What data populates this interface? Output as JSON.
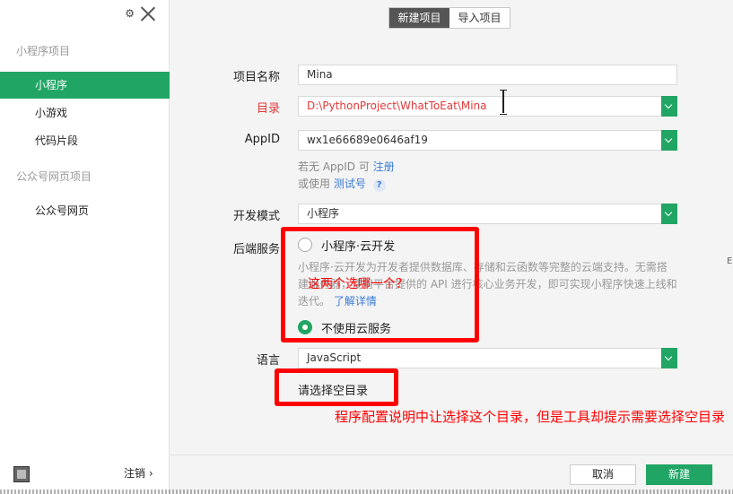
{
  "sidebar": {
    "settings_icon": "⚙",
    "section_miniprogram": "小程序项目",
    "items": [
      {
        "label": "小程序",
        "active": true
      },
      {
        "label": "小游戏",
        "active": false
      },
      {
        "label": "代码片段",
        "active": false
      }
    ],
    "section_official": "公众号网页项目",
    "official_item": "公众号网页",
    "logout_label": "注销 ›"
  },
  "tabs": [
    {
      "label": "新建项目",
      "active": true
    },
    {
      "label": "导入项目",
      "active": false
    }
  ],
  "form": {
    "project_name_label": "项目名称",
    "project_name_value": "Mina",
    "directory_label": "目录",
    "directory_value": "D:\\PythonProject\\WhatToEat\\Mina",
    "appid_label": "AppID",
    "appid_value": "wx1e66689e0646af19",
    "hint_no_appid": "若无 AppID 可",
    "hint_register": "注册",
    "hint_or_use": "或使用",
    "hint_test": "测试号",
    "hint_q": "?",
    "dev_mode_label": "开发模式",
    "dev_mode_value": "小程序",
    "backend_label": "后端服务",
    "option_cloud": "小程序·云开发",
    "cloud_desc_1": "小程序·云开发为开发者提供数据库、存储和云函数等完整的云端支持。无需搭",
    "cloud_desc_2": "建服务器，使用平台提供的 API 进行核心业务开发，即可实现小程序快速上线和",
    "cloud_desc_3": "迭代。",
    "learn_more": "了解详情",
    "option_none": "不使用云服务",
    "language_label": "语言",
    "language_value": "JavaScript",
    "choose_empty_dir": "请选择空目录"
  },
  "annotations": {
    "which_one": "这两个选哪一个？",
    "config_note": "程序配置说明中让选择这个目录，但是工具却提示需要选择空目录"
  },
  "footer": {
    "cancel": "取消",
    "create": "新建"
  },
  "side_mark": "E",
  "colors": {
    "accent": "#21a564",
    "annotation_red": "#ff0000",
    "error_red": "#e03a3a"
  }
}
